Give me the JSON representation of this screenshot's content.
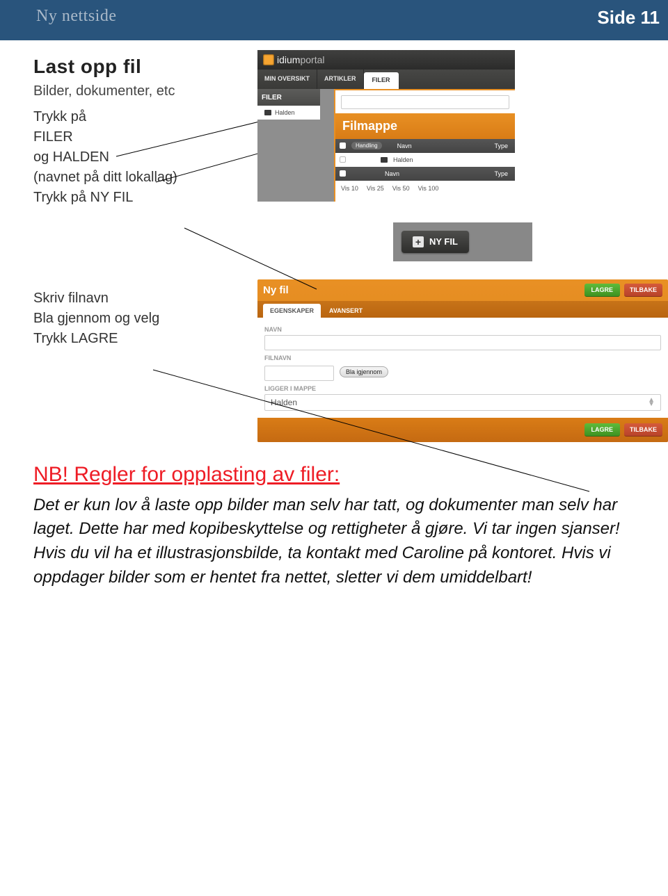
{
  "header": {
    "left": "Ny nettside",
    "right": "Side 11"
  },
  "instructions": {
    "title": "Last opp fil",
    "subtitle": "Bilder, dokumenter, etc",
    "step1": "Trykk på",
    "step2": "FILER",
    "step3": "og HALDEN",
    "step4": "(navnet på ditt lokallag)",
    "step5": "Trykk på NY FIL",
    "step6": "Skriv filnavn",
    "step7": "Bla gjennom og velg",
    "step8": "Trykk LAGRE"
  },
  "portal": {
    "brand_a": "idium",
    "brand_b": "portal",
    "menu": {
      "oversikt": "MIN OVERSIKT",
      "artikler": "ARTIKLER",
      "filer": "FILER"
    },
    "sidebar_header": "FILER",
    "folder": "Halden",
    "filmappe": "Filmappe",
    "cols": {
      "handling": "Handling",
      "navn": "Navn",
      "type": "Type"
    },
    "row_folder": "Halden",
    "pager": {
      "v10": "Vis 10",
      "v25": "Vis 25",
      "v50": "Vis 50",
      "v100": "Vis 100"
    }
  },
  "nyfil_button": "NY FIL",
  "form": {
    "title": "Ny fil",
    "lagre": "LAGRE",
    "tilbake": "TILBAKE",
    "tab_egenskaper": "EGENSKAPER",
    "tab_avansert": "AVANSERT",
    "label_navn": "NAVN",
    "label_filnavn": "FILNAVN",
    "bla": "Bla igjennom",
    "label_mappe": "LIGGER I MAPPE",
    "mappe_value": "Halden"
  },
  "rules": {
    "heading": "NB! Regler for opplasting av filer:",
    "body": "Det er kun lov å laste opp bilder man selv har tatt, og dokumenter man selv har laget. Dette har med kopibeskyttelse og rettigheter å gjøre. Vi tar ingen sjanser! Hvis du vil ha et illustrasjonsbilde, ta kontakt med Caroline på kontoret.\nHvis vi oppdager bilder som er hentet fra nettet, sletter vi dem umiddelbart!"
  }
}
